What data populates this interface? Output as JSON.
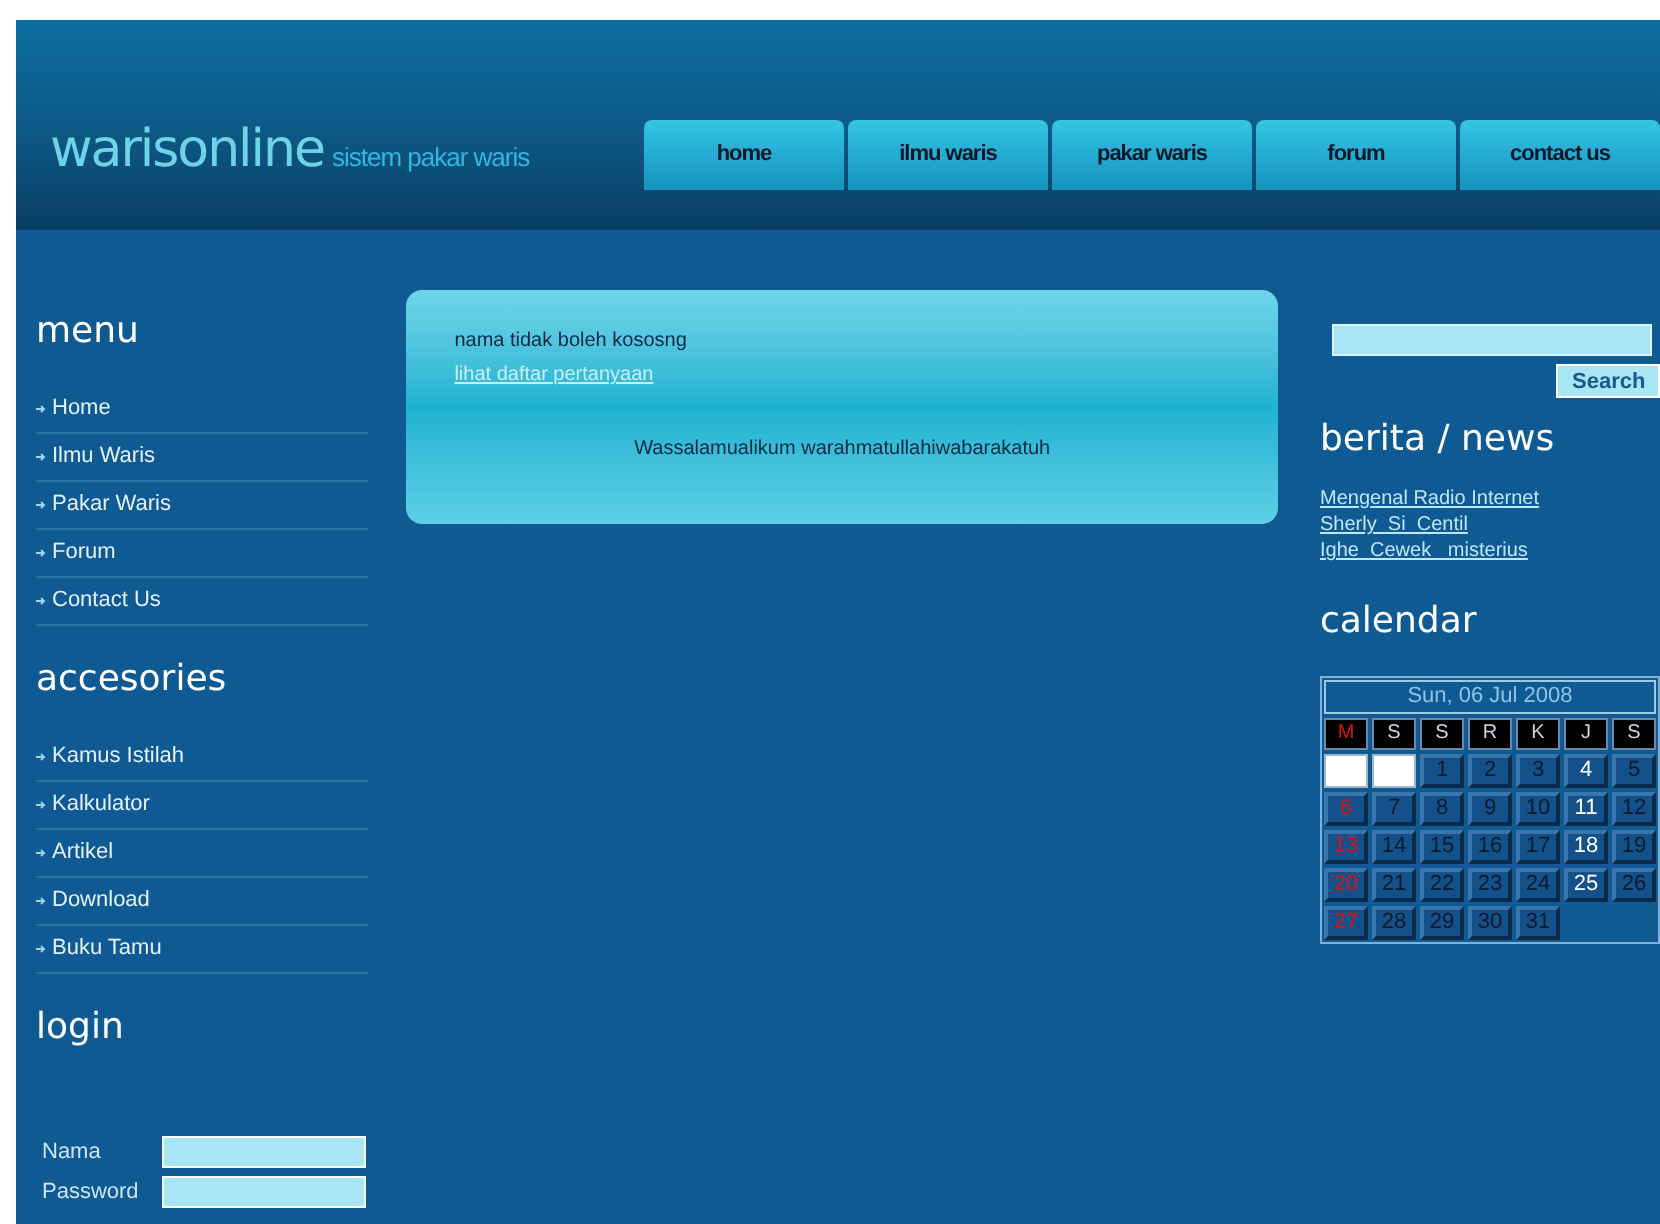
{
  "logo": {
    "title": "warisonline",
    "subtitle": "sistem pakar waris"
  },
  "nav": [
    {
      "label": "home"
    },
    {
      "label": "ilmu waris"
    },
    {
      "label": "pakar waris"
    },
    {
      "label": "forum"
    },
    {
      "label": "contact us"
    }
  ],
  "sidebar": [
    {
      "heading": "menu",
      "items": [
        "Home",
        "Ilmu Waris",
        "Pakar Waris",
        "Forum",
        "Contact Us"
      ]
    },
    {
      "heading": "accesories",
      "items": [
        "Kamus Istilah",
        "Kalkulator",
        "Artikel",
        "Download",
        "Buku Tamu"
      ]
    }
  ],
  "login": {
    "heading": "login",
    "fields": [
      {
        "label": "Nama"
      },
      {
        "label": "Password"
      }
    ]
  },
  "content": {
    "message": "nama tidak boleh kososng",
    "link": "lihat daftar pertanyaan",
    "greeting": "Wassalamualikum warahmatullahiwabarakatuh"
  },
  "search": {
    "button": "Search"
  },
  "news": {
    "heading": "berita / news",
    "links": [
      "Mengenal Radio Internet",
      "Sherly  Si  Centil",
      "Ighe  Cewek   misterius"
    ]
  },
  "calendar": {
    "heading": "calendar",
    "title": "Sun, 06 Jul 2008",
    "weekdays": [
      {
        "label": "M",
        "kind": "sunday"
      },
      {
        "label": "S",
        "kind": "day"
      },
      {
        "label": "S",
        "kind": "day"
      },
      {
        "label": "R",
        "kind": "day"
      },
      {
        "label": "K",
        "kind": "day"
      },
      {
        "label": "J",
        "kind": "day"
      },
      {
        "label": "S",
        "kind": "day"
      }
    ],
    "weeks": [
      [
        {
          "kind": "blank"
        },
        {
          "kind": "blank"
        },
        {
          "text": "1",
          "kind": "day"
        },
        {
          "text": "2",
          "kind": "day"
        },
        {
          "text": "3",
          "kind": "day"
        },
        {
          "text": "4",
          "kind": "friday"
        },
        {
          "text": "5",
          "kind": "day"
        }
      ],
      [
        {
          "text": "6",
          "kind": "sunday"
        },
        {
          "text": "7",
          "kind": "day"
        },
        {
          "text": "8",
          "kind": "day"
        },
        {
          "text": "9",
          "kind": "day"
        },
        {
          "text": "10",
          "kind": "day"
        },
        {
          "text": "11",
          "kind": "friday"
        },
        {
          "text": "12",
          "kind": "day"
        }
      ],
      [
        {
          "text": "13",
          "kind": "sunday"
        },
        {
          "text": "14",
          "kind": "day"
        },
        {
          "text": "15",
          "kind": "day"
        },
        {
          "text": "16",
          "kind": "day"
        },
        {
          "text": "17",
          "kind": "day"
        },
        {
          "text": "18",
          "kind": "friday"
        },
        {
          "text": "19",
          "kind": "day"
        }
      ],
      [
        {
          "text": "20",
          "kind": "sunday"
        },
        {
          "text": "21",
          "kind": "day"
        },
        {
          "text": "22",
          "kind": "day"
        },
        {
          "text": "23",
          "kind": "day"
        },
        {
          "text": "24",
          "kind": "day"
        },
        {
          "text": "25",
          "kind": "friday"
        },
        {
          "text": "26",
          "kind": "day"
        }
      ],
      [
        {
          "text": "27",
          "kind": "sunday"
        },
        {
          "text": "28",
          "kind": "day"
        },
        {
          "text": "29",
          "kind": "day"
        },
        {
          "text": "30",
          "kind": "day"
        },
        {
          "text": "31",
          "kind": "day"
        }
      ]
    ]
  }
}
